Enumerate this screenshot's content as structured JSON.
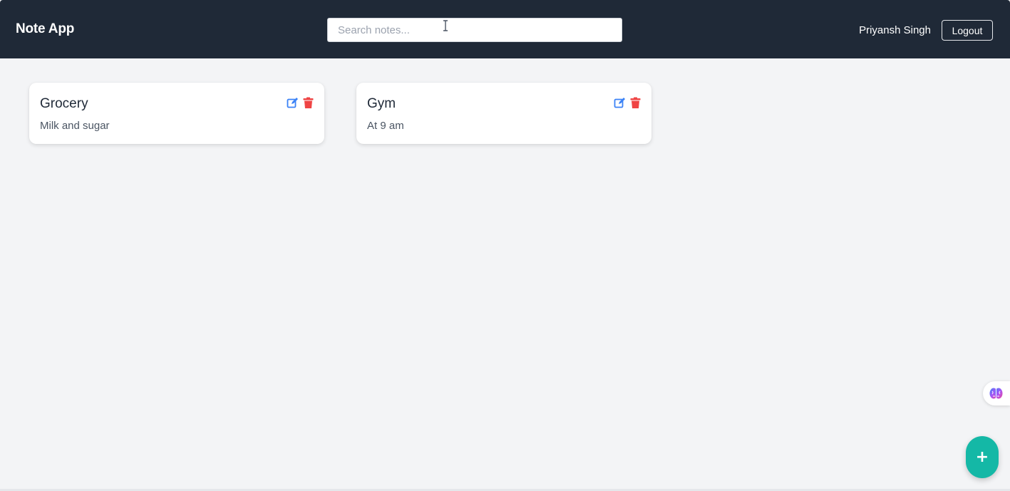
{
  "header": {
    "brand": "Note App",
    "search_placeholder": "Search notes...",
    "search_value": "",
    "user_name": "Priyansh Singh",
    "logout_label": "Logout"
  },
  "notes": [
    {
      "title": "Grocery",
      "body": "Milk and sugar"
    },
    {
      "title": "Gym",
      "body": "At 9 am"
    }
  ],
  "actions": {
    "add_label": "+"
  },
  "icons": {
    "edit": "edit-icon",
    "delete": "trash-icon",
    "brain": "brain-icon",
    "cursor": "text-cursor-icon"
  },
  "colors": {
    "navbar": "#1f2937",
    "background": "#f3f4f6",
    "edit": "#3b82f6",
    "delete": "#ef4444",
    "fab": "#14b8a6"
  }
}
